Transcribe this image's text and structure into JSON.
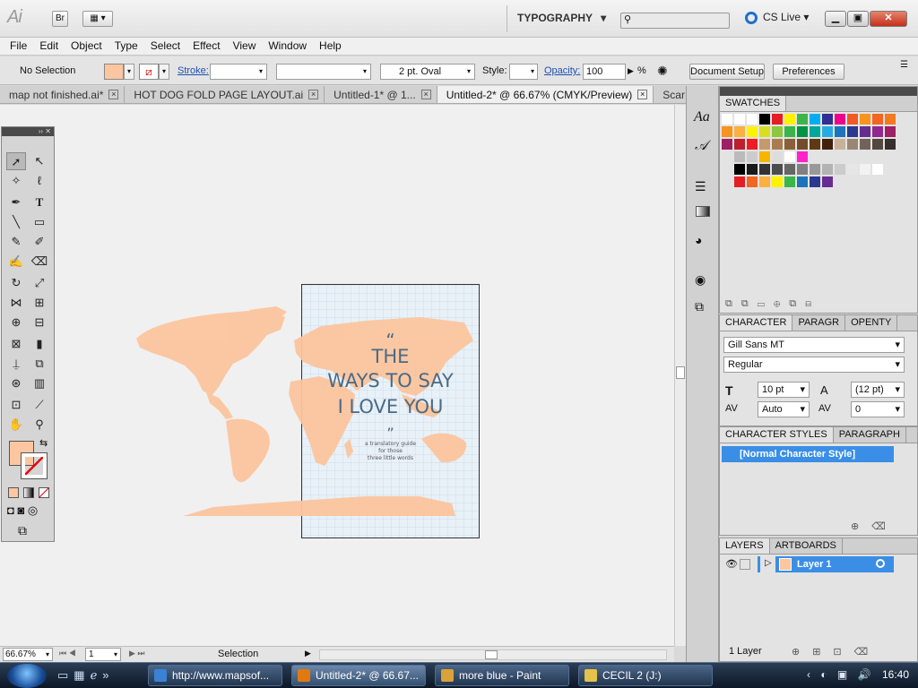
{
  "app": {
    "logo": "Ai",
    "bridge_btn": "Br",
    "workspace": "TYPOGRAPHY",
    "cs_live": "CS Live"
  },
  "menu": [
    "File",
    "Edit",
    "Object",
    "Type",
    "Select",
    "Effect",
    "View",
    "Window",
    "Help"
  ],
  "control": {
    "selection": "No Selection",
    "stroke_label": "Stroke:",
    "brush": "2 pt. Oval",
    "style_label": "Style:",
    "opacity_label": "Opacity:",
    "opacity_value": "100",
    "opacity_unit": "%",
    "doc_setup": "Document Setup",
    "preferences": "Preferences"
  },
  "tabs": [
    {
      "label": "map not finished.ai*"
    },
    {
      "label": "HOT DOG FOLD PAGE LAYOUT.ai"
    },
    {
      "label": "Untitled-1* @ 1..."
    },
    {
      "label": "Untitled-2* @ 66.67% (CMYK/Preview)"
    },
    {
      "label": "Scar"
    }
  ],
  "poster": {
    "open_quote": "“",
    "title_1": "THE",
    "title_2": "WAYS TO SAY",
    "title_3": "I LOVE YOU",
    "close_quote": "”",
    "sub_1": "a translatory guide",
    "sub_2": "for those",
    "sub_3": "three little words"
  },
  "status": {
    "zoom": "66.67%",
    "page": "1",
    "tool": "Selection"
  },
  "swatches_panel": {
    "title": "SWATCHES"
  },
  "character_panel": {
    "tabs": [
      "CHARACTER",
      "PARAGR",
      "OPENTY"
    ],
    "font": "Gill Sans MT",
    "style": "Regular",
    "size": "10 pt",
    "leading": "(12 pt)",
    "kerning": "Auto",
    "tracking": "0"
  },
  "char_styles_panel": {
    "tabs": [
      "CHARACTER STYLES",
      "PARAGRAPH"
    ],
    "item": "[Normal Character Style]"
  },
  "layers_panel": {
    "tabs": [
      "LAYERS",
      "ARTBOARDS"
    ],
    "layer": "Layer 1",
    "count": "1 Layer"
  },
  "taskbar": {
    "items": [
      {
        "label": "http://www.mapsof..."
      },
      {
        "label": "Untitled-2* @ 66.67..."
      },
      {
        "label": "more blue - Paint"
      },
      {
        "label": "CECIL 2 (J:)"
      }
    ],
    "time": "16:40"
  },
  "colors": {
    "fill": "#fcc7a0",
    "map": "#fbc59e",
    "accent": "#3a8ee6",
    "title": "#4a6a86"
  }
}
